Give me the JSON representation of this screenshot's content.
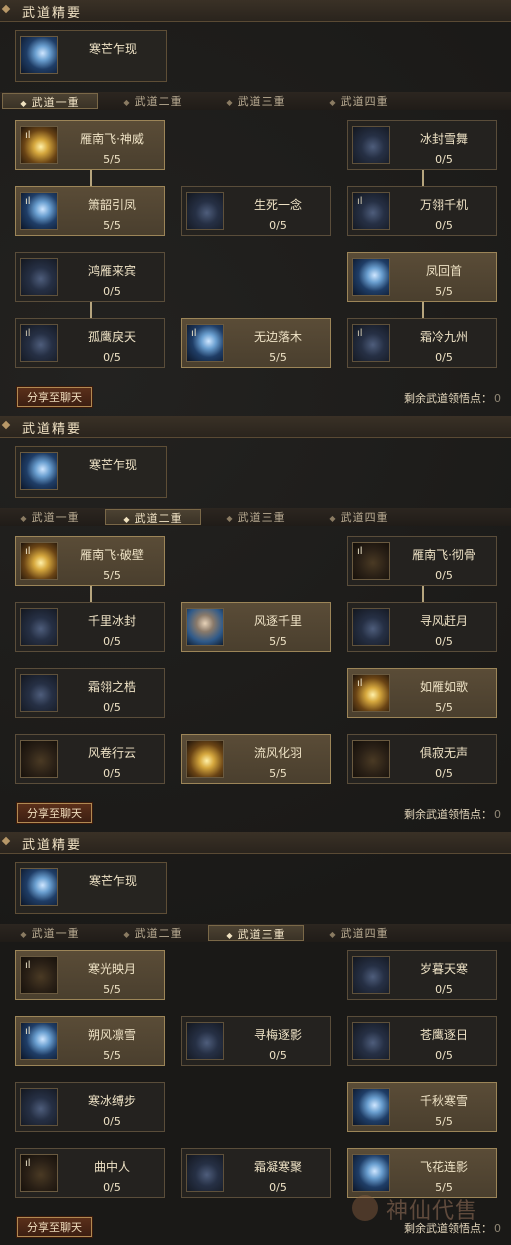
{
  "sections": [
    {
      "header_title": "武道精要",
      "essence": {
        "name": "寒芒乍现",
        "icon": "sword-ice-icon"
      },
      "tabs": [
        "武道一重",
        "武道二重",
        "武道三重",
        "武道四重"
      ],
      "active_tab": 0,
      "nodes": [
        {
          "name": "雁南飞·神威",
          "points": "5/5",
          "icon": "gold-feather-icon",
          "lit": true
        },
        {
          "name": "冰封雪舞",
          "points": "0/5",
          "icon": "ice-storm-icon",
          "lit": false
        },
        {
          "name": "箫韶引凤",
          "points": "5/5",
          "icon": "ice-phoenix-icon",
          "lit": true
        },
        {
          "name": "生死一念",
          "points": "0/5",
          "icon": "dark-ice-icon",
          "lit": false
        },
        {
          "name": "万翎千机",
          "points": "0/5",
          "icon": "ice-blade-icon",
          "lit": false
        },
        {
          "name": "鸿雁来宾",
          "points": "0/5",
          "icon": "gold-wing-icon",
          "lit": false
        },
        {
          "name": "凤回首",
          "points": "5/5",
          "icon": "ice-swirl-icon",
          "lit": true
        },
        {
          "name": "孤鹰戾天",
          "points": "0/5",
          "icon": "ice-hawk-icon",
          "lit": false
        },
        {
          "name": "无边落木",
          "points": "5/5",
          "icon": "ice-fall-icon",
          "lit": true
        },
        {
          "name": "霜冷九州",
          "points": "0/5",
          "icon": "frost-icon",
          "lit": false
        }
      ],
      "share_label": "分享至聊天",
      "remain_label": "剩余武道领悟点：",
      "remain_value": "0"
    },
    {
      "header_title": "武道精要",
      "essence": {
        "name": "寒芒乍现",
        "icon": "sword-ice-icon"
      },
      "tabs": [
        "武道一重",
        "武道二重",
        "武道三重",
        "武道四重"
      ],
      "active_tab": 1,
      "nodes": [
        {
          "name": "雁南飞·破壁",
          "points": "5/5",
          "icon": "gold-feather-icon",
          "lit": true
        },
        {
          "name": "雁南飞·彻骨",
          "points": "0/5",
          "icon": "gold-strike-icon",
          "lit": false
        },
        {
          "name": "千里冰封",
          "points": "0/5",
          "icon": "ice-seal-icon",
          "lit": false
        },
        {
          "name": "风逐千里",
          "points": "5/5",
          "icon": "face-wind-icon",
          "lit": true
        },
        {
          "name": "寻风赶月",
          "points": "0/5",
          "icon": "moon-wind-icon",
          "lit": false
        },
        {
          "name": "霜翎之梏",
          "points": "0/5",
          "icon": "frost-shackle-icon",
          "lit": false
        },
        {
          "name": "如雁如歌",
          "points": "5/5",
          "icon": "gold-goose-icon",
          "lit": true
        },
        {
          "name": "风卷行云",
          "points": "0/5",
          "icon": "gold-cloud-icon",
          "lit": false
        },
        {
          "name": "流风化羽",
          "points": "5/5",
          "icon": "gold-feather-flow-icon",
          "lit": true
        },
        {
          "name": "俱寂无声",
          "points": "0/5",
          "icon": "silence-icon",
          "lit": false
        }
      ],
      "share_label": "分享至聊天",
      "remain_label": "剩余武道领悟点：",
      "remain_value": "0"
    },
    {
      "header_title": "武道精要",
      "essence": {
        "name": "寒芒乍现",
        "icon": "sword-ice-icon"
      },
      "tabs": [
        "武道一重",
        "武道二重",
        "武道三重",
        "武道四重"
      ],
      "active_tab": 2,
      "nodes": [
        {
          "name": "寒光映月",
          "points": "5/5",
          "icon": "moon-ice-icon",
          "lit": true
        },
        {
          "name": "岁暮天寒",
          "points": "0/5",
          "icon": "cold-sky-icon",
          "lit": false
        },
        {
          "name": "朔风凛雪",
          "points": "5/5",
          "icon": "snow-wind-icon",
          "lit": true
        },
        {
          "name": "寻梅逐影",
          "points": "0/5",
          "icon": "plum-shadow-icon",
          "lit": false
        },
        {
          "name": "苍鹰逐日",
          "points": "0/5",
          "icon": "hawk-sun-icon",
          "lit": false
        },
        {
          "name": "寒冰缚步",
          "points": "0/5",
          "icon": "ice-bind-icon",
          "lit": false
        },
        {
          "name": "千秋寒雪",
          "points": "5/5",
          "icon": "eternal-snow-icon",
          "lit": true
        },
        {
          "name": "曲中人",
          "points": "0/5",
          "icon": "music-person-icon",
          "lit": false
        },
        {
          "name": "霜凝寒聚",
          "points": "0/5",
          "icon": "frost-gather-icon",
          "lit": false
        },
        {
          "name": "飞花连影",
          "points": "5/5",
          "icon": "flying-flower-icon",
          "lit": true
        }
      ],
      "share_label": "分享至聊天",
      "remain_label": "剩余武道领悟点：",
      "remain_value": "0"
    }
  ],
  "watermark_text": "神仙代售"
}
